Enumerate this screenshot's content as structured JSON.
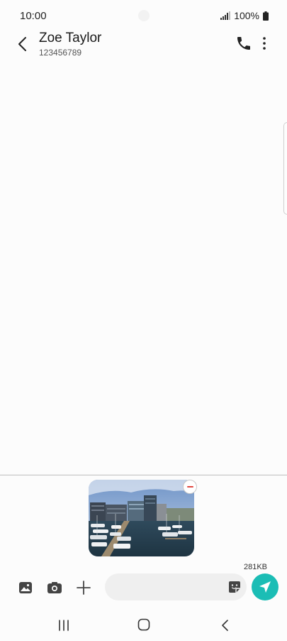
{
  "status_bar": {
    "time": "10:00",
    "battery": "100%",
    "icons": [
      "signal-icon",
      "battery-icon"
    ]
  },
  "header": {
    "contact_name": "Zoe Taylor",
    "contact_number": "123456789",
    "icons": [
      "back-arrow-icon",
      "phone-icon",
      "more-vertical-icon"
    ]
  },
  "composer": {
    "attachment": {
      "type": "image",
      "subject": "harbor marina with boats and buildings",
      "size_label": "281KB"
    },
    "input_value": "",
    "input_placeholder": "",
    "icons": [
      "gallery-icon",
      "camera-icon",
      "plus-icon",
      "sticker-icon",
      "send-icon"
    ],
    "send_color": "#1bbdb5"
  },
  "nav_bar": {
    "icons": [
      "recents-icon",
      "home-icon",
      "back-icon"
    ]
  }
}
